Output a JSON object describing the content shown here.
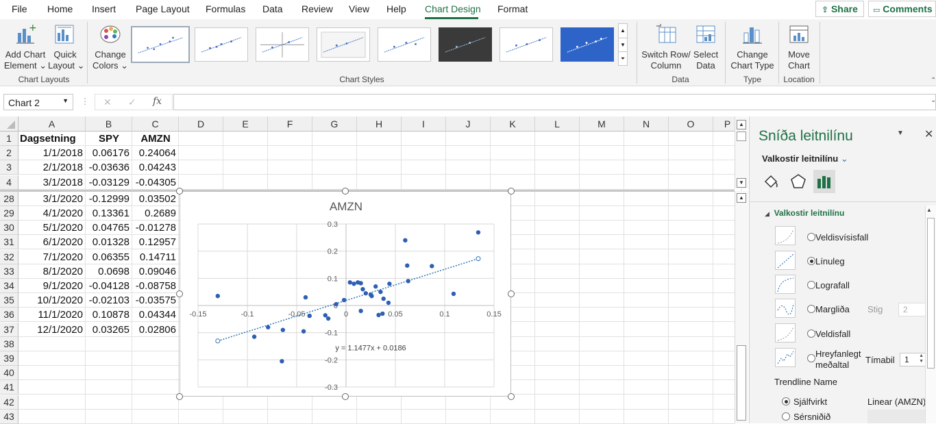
{
  "menu": {
    "tabs": [
      "File",
      "Home",
      "Insert",
      "Page Layout",
      "Formulas",
      "Data",
      "Review",
      "View",
      "Help",
      "Chart Design",
      "Format"
    ],
    "active_tab": "Chart Design",
    "share_label": "Share",
    "comments_label": "Comments"
  },
  "ribbon": {
    "add_chart_element": [
      "Add Chart",
      "Element ⌄"
    ],
    "quick_layout": [
      "Quick",
      "Layout ⌄"
    ],
    "change_colors": [
      "Change",
      "Colors ⌄"
    ],
    "group_chart_layouts": "Chart Layouts",
    "group_chart_styles": "Chart Styles",
    "switch_row_column": [
      "Switch Row/",
      "Column"
    ],
    "select_data": [
      "Select",
      "Data"
    ],
    "group_data": "Data",
    "change_chart_type": [
      "Change",
      "Chart Type"
    ],
    "group_type": "Type",
    "move_chart": [
      "Move",
      "Chart"
    ],
    "group_location": "Location"
  },
  "formula_bar": {
    "name_box": "Chart 2",
    "fx": "fx",
    "formula": ""
  },
  "sheet": {
    "columns": [
      "A",
      "B",
      "C",
      "D",
      "E",
      "F",
      "G",
      "H",
      "I",
      "J",
      "K",
      "L",
      "M",
      "N",
      "O",
      "P"
    ],
    "row_numbers": [
      "1",
      "2",
      "3",
      "4",
      "28",
      "29",
      "30",
      "31",
      "32",
      "33",
      "34",
      "35",
      "36",
      "37",
      "38",
      "39",
      "40",
      "41",
      "42",
      "43"
    ],
    "header": [
      "Dagsetning",
      "SPY",
      "AMZN"
    ],
    "rows": [
      [
        "1/1/2018",
        "0.06176",
        "0.24064"
      ],
      [
        "2/1/2018",
        "-0.03636",
        "0.04243"
      ],
      [
        "3/1/2018",
        "-0.03129",
        "-0.04305"
      ],
      [
        "3/1/2020",
        "-0.12999",
        "0.03502"
      ],
      [
        "4/1/2020",
        "0.13361",
        "0.2689"
      ],
      [
        "5/1/2020",
        "0.04765",
        "-0.01278"
      ],
      [
        "6/1/2020",
        "0.01328",
        "0.12957"
      ],
      [
        "7/1/2020",
        "0.06355",
        "0.14711"
      ],
      [
        "8/1/2020",
        "0.0698",
        "0.09046"
      ],
      [
        "9/1/2020",
        "-0.04128",
        "-0.08758"
      ],
      [
        "10/1/2020",
        "-0.02103",
        "-0.03575"
      ],
      [
        "11/1/2020",
        "0.10878",
        "0.04344"
      ],
      [
        "12/1/2020",
        "0.03265",
        "0.02806"
      ]
    ]
  },
  "chart_data": {
    "type": "scatter",
    "title": "AMZN",
    "xlim": [
      -0.15,
      0.15
    ],
    "ylim": [
      -0.3,
      0.3
    ],
    "x_ticks": [
      "-0.15",
      "-0.1",
      "-0.05",
      "0",
      "0.05",
      "0.1",
      "0.15"
    ],
    "y_ticks": [
      "0.3",
      "0.2",
      "0.1",
      "0",
      "-0.1",
      "-0.2",
      "-0.3"
    ],
    "grid": true,
    "points": [
      [
        -0.13,
        0.035
      ],
      [
        -0.093,
        -0.115
      ],
      [
        -0.079,
        -0.08
      ],
      [
        -0.065,
        -0.205
      ],
      [
        -0.064,
        -0.09
      ],
      [
        -0.043,
        -0.095
      ],
      [
        -0.041,
        0.03
      ],
      [
        -0.037,
        -0.038
      ],
      [
        -0.021,
        -0.036
      ],
      [
        -0.018,
        -0.048
      ],
      [
        -0.01,
        0.005
      ],
      [
        -0.002,
        0.02
      ],
      [
        0.004,
        0.085
      ],
      [
        0.008,
        0.08
      ],
      [
        0.012,
        0.085
      ],
      [
        0.015,
        0.082
      ],
      [
        0.017,
        0.06
      ],
      [
        0.02,
        0.045
      ],
      [
        0.025,
        0.04
      ],
      [
        0.026,
        0.035
      ],
      [
        0.03,
        0.07
      ],
      [
        0.033,
        -0.035
      ],
      [
        0.035,
        0.05
      ],
      [
        0.038,
        0.025
      ],
      [
        0.043,
        0.01
      ],
      [
        0.044,
        0.08
      ],
      [
        0.06,
        0.24
      ],
      [
        0.062,
        0.147
      ],
      [
        0.063,
        0.09
      ],
      [
        0.087,
        0.145
      ],
      [
        0.109,
        0.043
      ],
      [
        0.134,
        0.269
      ],
      [
        0.015,
        -0.02
      ],
      [
        0.037,
        -0.03
      ]
    ],
    "trendline": {
      "slope": 1.1477,
      "intercept": 0.0186,
      "x_range": [
        -0.13,
        0.134
      ]
    },
    "equation": "y = 1.1477x + 0.0186"
  },
  "pane": {
    "title": "Sníða leitnilínu",
    "options_dropdown": "Valkostir leitnilínu",
    "section": "Valkostir leitnilínu",
    "options": [
      {
        "label": "Veldisvísisfall",
        "selected": false
      },
      {
        "label": "Línuleg",
        "selected": true
      },
      {
        "label": "Lografall",
        "selected": false
      },
      {
        "label": "Margliða",
        "selected": false
      },
      {
        "label": "Veldisfall",
        "selected": false
      },
      {
        "label": "Hreyfanlegt meðaltal",
        "selected": false
      }
    ],
    "order_label": "Stig",
    "order_value": "2",
    "period_label": "Tímabil",
    "period_value": "1",
    "trendline_name_label": "Trendline Name",
    "automatic_label": "Sjálfvirkt",
    "automatic_value": "Linear (AMZN)",
    "custom_label": "Sérsniðið"
  }
}
